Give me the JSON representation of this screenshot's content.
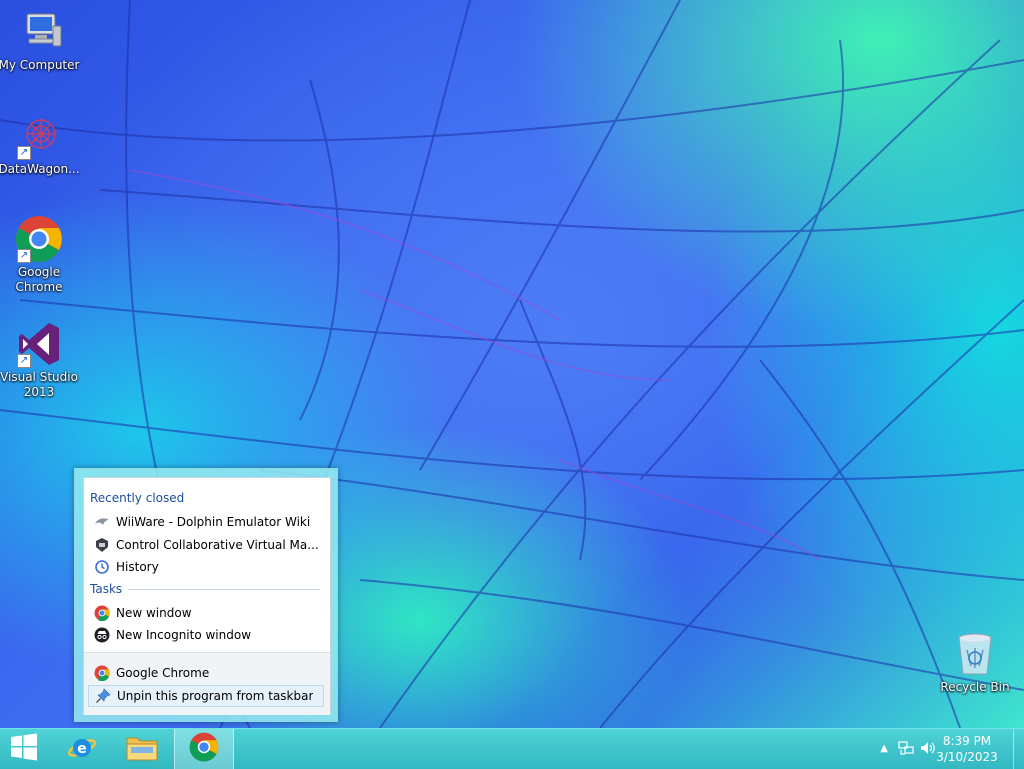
{
  "desktop": {
    "icons": [
      {
        "label": "My Computer",
        "icon": "computer-icon"
      },
      {
        "label": "DataWagon...",
        "icon": "datawagon-icon"
      },
      {
        "label": "Google Chrome",
        "icon": "chrome-icon"
      },
      {
        "label": "Visual Studio 2013",
        "icon": "visual-studio-icon"
      },
      {
        "label": "Recycle Bin",
        "icon": "recycle-bin-icon"
      }
    ]
  },
  "jumplist": {
    "recent_heading": "Recently closed",
    "recent": [
      {
        "label": "WiiWare - Dolphin Emulator Wiki",
        "icon": "dolphin-icon"
      },
      {
        "label": "Control Collaborative Virtual Ma...",
        "icon": "pad-icon"
      },
      {
        "label": "History",
        "icon": "history-icon"
      }
    ],
    "tasks_heading": "Tasks",
    "tasks": [
      {
        "label": "New window",
        "icon": "chrome-icon"
      },
      {
        "label": "New Incognito window",
        "icon": "incognito-icon"
      }
    ],
    "app": {
      "label": "Google Chrome",
      "icon": "chrome-icon"
    },
    "unpin": {
      "label": "Unpin this program from taskbar",
      "icon": "pin-icon"
    }
  },
  "taskbar": {
    "apps": [
      "start-icon",
      "internet-explorer-icon",
      "file-explorer-icon",
      "chrome-icon"
    ],
    "clock": {
      "time": "8:39 PM",
      "date": "3/10/2023"
    }
  },
  "colors": {
    "taskbar": "#3fc6cc",
    "heading": "#1e4fa3",
    "hover": "#e5f1fb"
  }
}
